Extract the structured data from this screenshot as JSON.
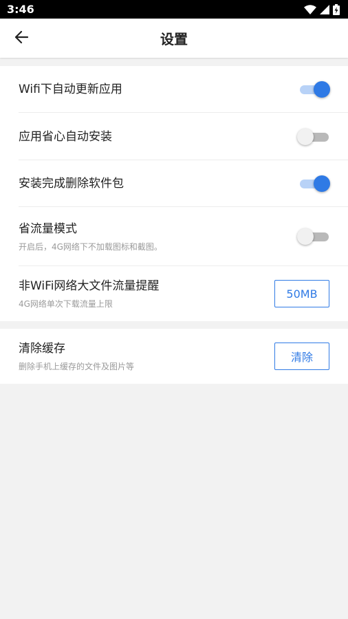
{
  "status_bar": {
    "time": "3:46"
  },
  "header": {
    "title": "设置"
  },
  "settings": {
    "wifi_update": {
      "title": "Wifi下自动更新应用",
      "enabled": true
    },
    "auto_install": {
      "title": "应用省心自动安装",
      "enabled": false
    },
    "delete_package": {
      "title": "安装完成删除软件包",
      "enabled": true
    },
    "data_saver": {
      "title": "省流量模式",
      "subtitle": "开启后，4G网络下不加载图标和截图。",
      "enabled": false
    },
    "large_file_alert": {
      "title": "非WiFi网络大文件流量提醒",
      "subtitle": "4G网络单次下载流量上限",
      "value": "50MB"
    }
  },
  "cache": {
    "title": "清除缓存",
    "subtitle": "删除手机上缓存的文件及图片等",
    "button_label": "清除"
  },
  "colors": {
    "accent": "#2f7ae5",
    "background": "#f2f2f2"
  }
}
